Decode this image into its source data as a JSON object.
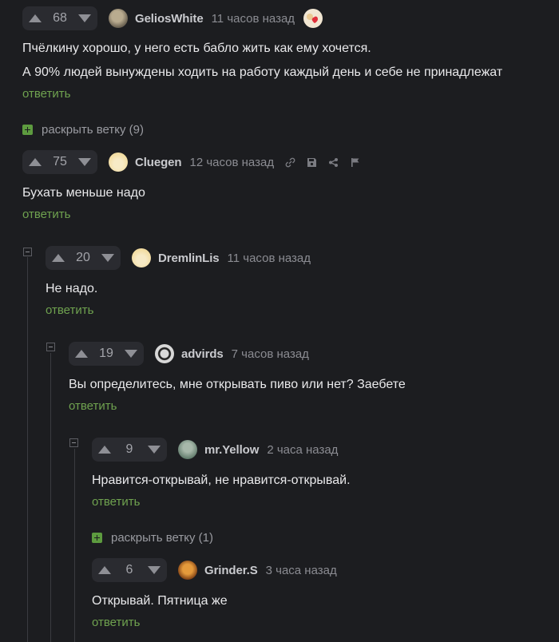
{
  "comments": [
    {
      "score": "68",
      "username": "GeliosWhite",
      "time": "11 часов назад",
      "lines": [
        "Пчёлкину хорошо, у него есть бабло жить как ему хочется.",
        "А 90% людей вынуждены ходить на работу каждый день и себе не принадлежат"
      ],
      "reply": "ответить",
      "avatar_colors": [
        "#6b6252",
        "#b9ab8f"
      ]
    },
    {
      "score": "75",
      "username": "Cluegen",
      "time": "12 часов назад",
      "lines": [
        "Бухать меньше надо"
      ],
      "reply": "ответить",
      "avatar_colors": [
        "#f2dca0",
        "#f7eac6"
      ]
    },
    {
      "score": "20",
      "username": "DremlinLis",
      "time": "11 часов назад",
      "lines": [
        "Не надо."
      ],
      "reply": "ответить",
      "avatar_colors": [
        "#f2dca0",
        "#f7eac6"
      ]
    },
    {
      "score": "19",
      "username": "advirds",
      "time": "7 часов назад",
      "lines": [
        "Вы определитесь, мне открывать пиво или нет? Заебете"
      ],
      "reply": "ответить",
      "avatar_colors": [
        "#222222",
        "#d8d8d8"
      ]
    },
    {
      "score": "9",
      "username": "mr.Yellow",
      "time": "2 часа назад",
      "lines": [
        "Нравится-открывай, не нравится-открывай."
      ],
      "reply": "ответить",
      "avatar_colors": [
        "#5f7a6a",
        "#a7b8aa"
      ]
    },
    {
      "score": "6",
      "username": "Grinder.S",
      "time": "3 часа назад",
      "lines": [
        "Открывай. Пятница же"
      ],
      "reply": "ответить",
      "avatar_colors": [
        "#7a3b12",
        "#e59a3b"
      ]
    }
  ],
  "expand_links": [
    {
      "label": "раскрыть ветку (9)"
    },
    {
      "label": "раскрыть ветку (1)"
    }
  ],
  "colors": {
    "background": "#1c1d20",
    "reply_link": "#6fa24f",
    "expand_icon": "#5d9b3f",
    "vote_pill": "#2a2b30"
  },
  "icons": {
    "comment_tools": [
      "link-icon",
      "save-icon",
      "share-icon",
      "flag-icon"
    ],
    "badge": "heart-badge-icon"
  }
}
